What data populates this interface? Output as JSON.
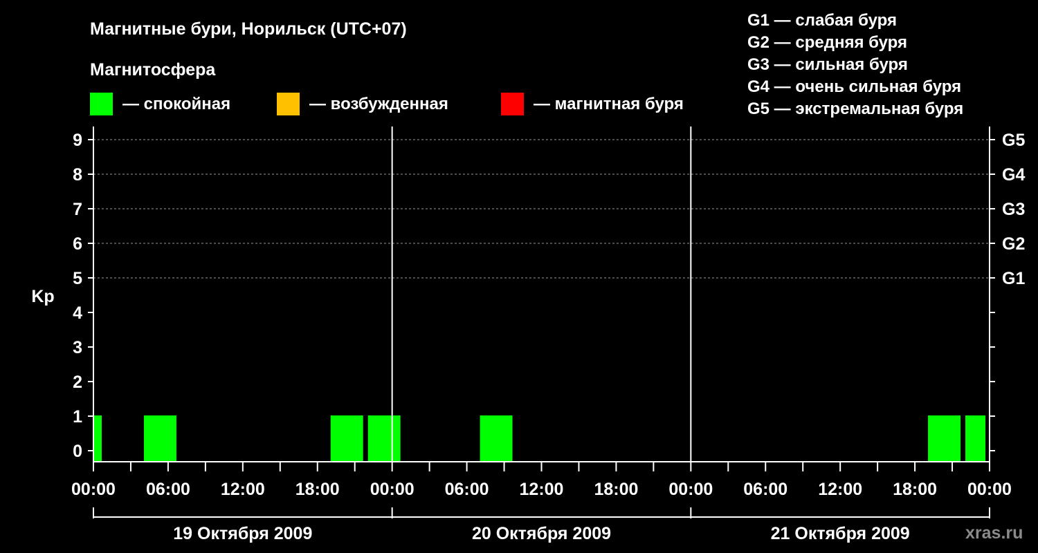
{
  "chart_data": {
    "type": "bar",
    "title": "Магнитные бури, Норильск (UTC+07)",
    "subtitle": "Магнитосфера",
    "ylabel": "Kp",
    "ylim": [
      0,
      9
    ],
    "y_ticks": [
      "0",
      "1",
      "2",
      "3",
      "4",
      "5",
      "6",
      "7",
      "8",
      "9"
    ],
    "g_scale": [
      {
        "kp": 5,
        "label": "G1",
        "description": "G1 — слабая буря"
      },
      {
        "kp": 6,
        "label": "G2",
        "description": "G2 — средняя буря"
      },
      {
        "kp": 7,
        "label": "G3",
        "description": "G3 — сильная буря"
      },
      {
        "kp": 8,
        "label": "G4",
        "description": "G4 — очень сильная буря"
      },
      {
        "kp": 9,
        "label": "G5",
        "description": "G5 — экстремальная буря"
      }
    ],
    "legend": [
      {
        "label": "— спокойная",
        "color": "#00ff00"
      },
      {
        "label": "— возбужденная",
        "color": "#ffc000"
      },
      {
        "label": "— магнитная буря",
        "color": "#ff0000"
      }
    ],
    "x_ticks": [
      "00:00",
      "06:00",
      "12:00",
      "18:00",
      "00:00",
      "06:00",
      "12:00",
      "18:00",
      "00:00",
      "06:00",
      "12:00",
      "18:00",
      "00:00"
    ],
    "days": [
      "19 Октября 2009",
      "20 Октября 2009",
      "21 Октября 2009"
    ],
    "grid": true,
    "series": [
      {
        "bars": [
          {
            "start_hour": 0,
            "end_hour": 1,
            "kp": 1,
            "color": "#00ff00"
          },
          {
            "start_hour": 4,
            "end_hour": 7,
            "kp": 1,
            "color": "#00ff00"
          },
          {
            "start_hour": 19,
            "end_hour": 22,
            "kp": 1,
            "color": "#00ff00"
          },
          {
            "start_hour": 22,
            "end_hour": 25,
            "kp": 1,
            "color": "#00ff00"
          },
          {
            "start_hour": 31,
            "end_hour": 34,
            "kp": 1,
            "color": "#00ff00"
          },
          {
            "start_hour": 67,
            "end_hour": 70,
            "kp": 1,
            "color": "#00ff00"
          },
          {
            "start_hour": 70,
            "end_hour": 72,
            "kp": 1,
            "color": "#00ff00"
          }
        ]
      }
    ]
  },
  "watermark": "xras.ru"
}
